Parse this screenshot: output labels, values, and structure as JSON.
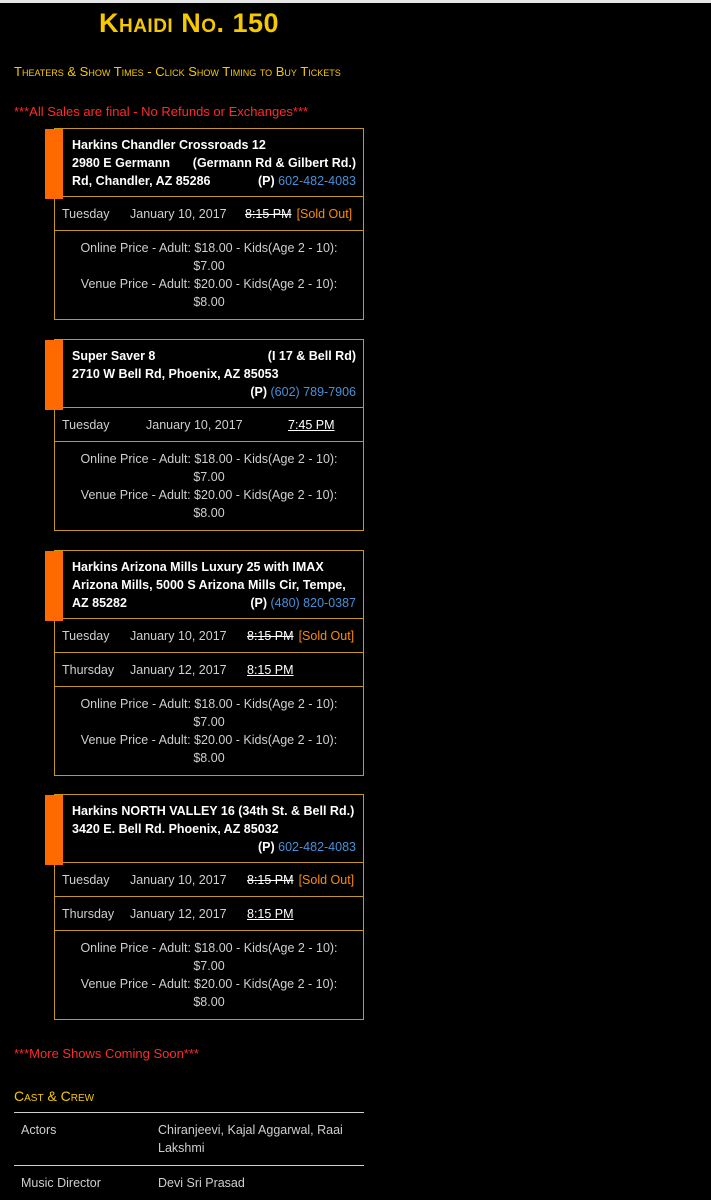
{
  "movie_title": "Khaidi No. 150",
  "theaters_heading": "Theaters & Show Times - Click Show Timing to Buy Tickets",
  "sales_notice": "***All Sales are final - No Refunds or Exchanges***",
  "theaters": [
    {
      "name_line_left": "Harkins Chandler Crossroads 12",
      "name_line_right": "",
      "addr_line_left": "2980 E Germann",
      "addr_line_right": "(Germann Rd & Gilbert Rd.)",
      "third_left": "Rd, Chandler, AZ 85286",
      "phone_prefix": "(P)",
      "phone": "602-482-4083",
      "shows": [
        {
          "day": "Tuesday",
          "date": "January 10, 2017",
          "time": "8:15 PM",
          "sold_out_label": "[Sold Out]"
        }
      ],
      "online_price": "Online Price - Adult: $18.00 - Kids(Age 2 - 10): $7.00",
      "venue_price": "Venue Price - Adult: $20.00 - Kids(Age 2 - 10): $8.00"
    },
    {
      "name_line_left": "Super Saver 8",
      "name_line_right": "(I 17 & Bell Rd)",
      "addr_line_left": "2710 W Bell Rd, Phoenix, AZ 85053",
      "addr_line_right": "",
      "third_left": "",
      "phone_prefix": "(P)",
      "phone": "(602) 789-7906",
      "shows": [
        {
          "day": "Tuesday",
          "date": "January 10, 2017",
          "time": "7:45 PM",
          "sold_out_label": ""
        }
      ],
      "online_price": "Online Price - Adult: $18.00 - Kids(Age 2 - 10): $7.00",
      "venue_price": "Venue Price - Adult: $20.00 - Kids(Age 2 - 10): $8.00"
    },
    {
      "name_line_left": "Harkins Arizona Mills Luxury 25 with IMAX",
      "name_line_right": "",
      "addr_line_left": "Arizona Mills, 5000 S Arizona Mills Cir, Tempe,",
      "addr_line_right": "",
      "third_left": "AZ 85282",
      "phone_prefix": "(P)",
      "phone": "(480) 820-0387",
      "shows": [
        {
          "day": "Tuesday",
          "date": "January 10, 2017",
          "time": "8:15 PM",
          "sold_out_label": "[Sold Out]"
        },
        {
          "day": "Thursday",
          "date": "January 12, 2017",
          "time": "8:15 PM",
          "sold_out_label": ""
        }
      ],
      "online_price": "Online Price - Adult: $18.00 - Kids(Age 2 - 10): $7.00",
      "venue_price": "Venue Price - Adult: $20.00 - Kids(Age 2 - 10): $8.00"
    },
    {
      "name_line_left": "Harkins NORTH VALLEY 16 (34th St. & Bell Rd.)",
      "name_line_right": "",
      "addr_line_left": "3420 E. Bell Rd. Phoenix, AZ 85032",
      "addr_line_right": "",
      "third_left": "",
      "phone_prefix": "(P)",
      "phone": "602-482-4083",
      "shows": [
        {
          "day": "Tuesday",
          "date": "January 10, 2017",
          "time": "8:15 PM",
          "sold_out_label": "[Sold Out]"
        },
        {
          "day": "Thursday",
          "date": "January 12, 2017",
          "time": "8:15 PM",
          "sold_out_label": ""
        }
      ],
      "online_price": "Online Price - Adult: $18.00 - Kids(Age 2 - 10): $7.00",
      "venue_price": "Venue Price - Adult: $20.00 - Kids(Age 2 - 10): $8.00"
    }
  ],
  "more_shows_notice": "***More Shows Coming Soon***",
  "cast_heading": "Cast & Crew",
  "cast": [
    {
      "role": "Actors",
      "names": "Chiranjeevi, Kajal Aggarwal, Raai Lakshmi"
    },
    {
      "role": "Music Director",
      "names": "Devi Sri Prasad"
    }
  ]
}
